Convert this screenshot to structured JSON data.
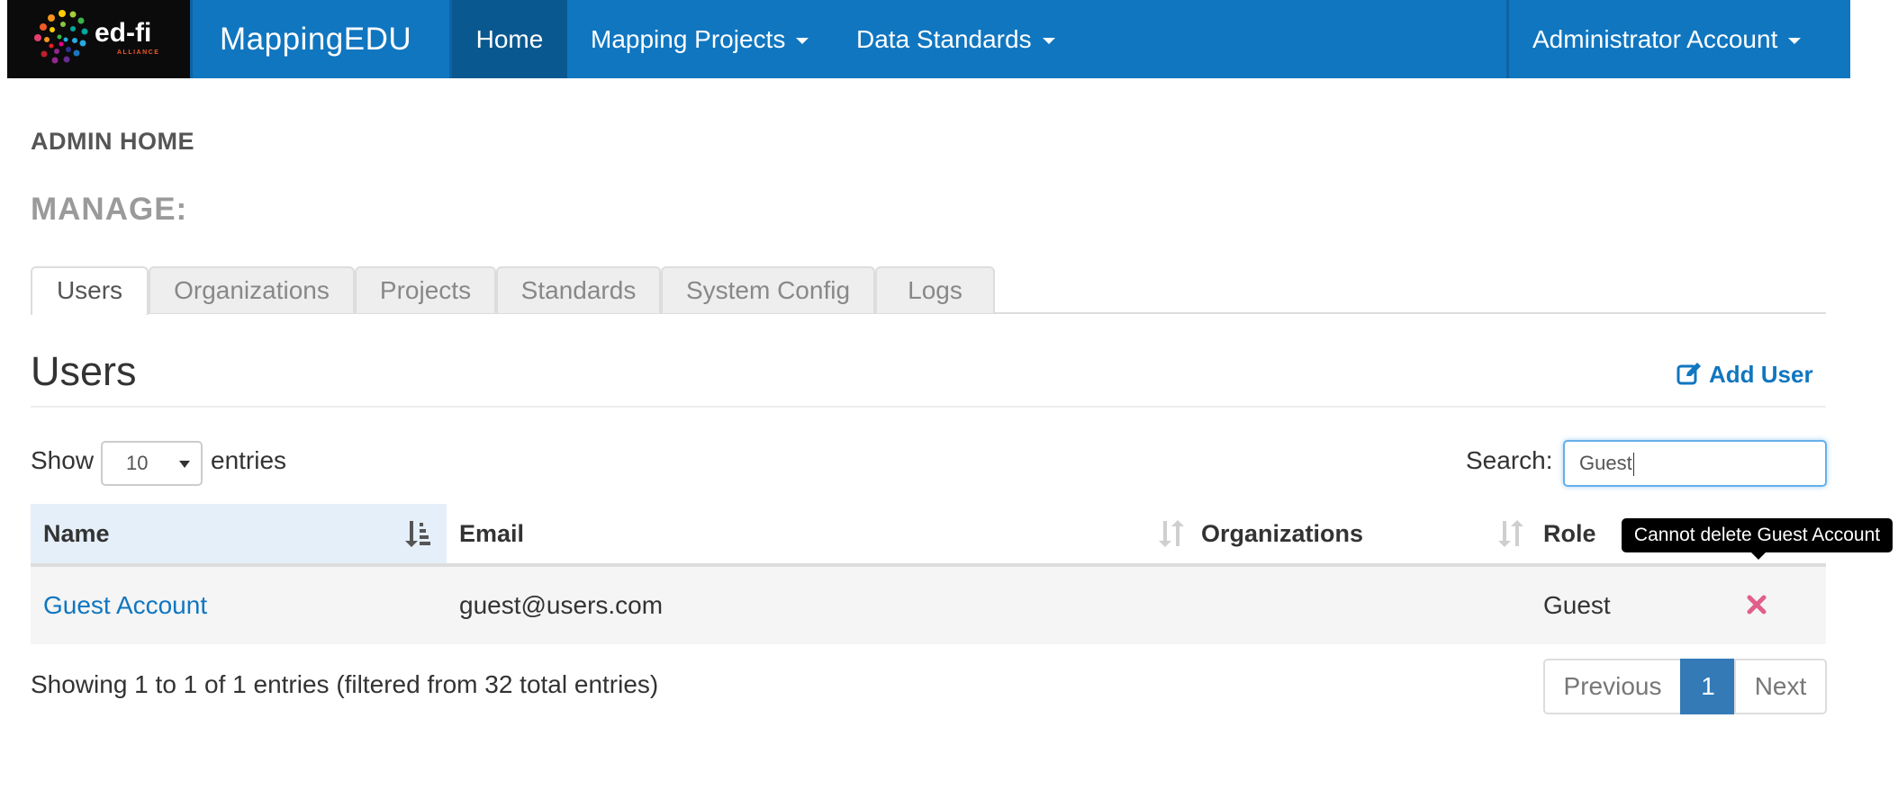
{
  "navbar": {
    "logo": {
      "wordmark": "ed-fi",
      "sub": "ALLIANCE"
    },
    "app_name": "MappingEDU",
    "items": [
      {
        "label": "Home",
        "active": true
      },
      {
        "label": "Mapping Projects",
        "dropdown": true
      },
      {
        "label": "Data Standards",
        "dropdown": true
      }
    ],
    "account": {
      "label": "Administrator Account",
      "dropdown": true
    },
    "colors": {
      "bar": "#1076c0",
      "active": "#0a5890",
      "logo_bg": "#0b0b0b"
    }
  },
  "page": {
    "heading": "ADMIN HOME",
    "manage_label": "MANAGE:"
  },
  "tabs": [
    {
      "label": "Users",
      "active": true
    },
    {
      "label": "Organizations"
    },
    {
      "label": "Projects"
    },
    {
      "label": "Standards"
    },
    {
      "label": "System Config"
    },
    {
      "label": "Logs"
    }
  ],
  "users": {
    "title": "Users",
    "add_label": "Add User",
    "add_icon": "edit-icon",
    "length": {
      "show": "Show",
      "value": "10",
      "entries": "entries"
    },
    "search": {
      "label": "Search:",
      "value": "Guest"
    },
    "columns": [
      {
        "label": "Name",
        "sort": "ascending"
      },
      {
        "label": "Email",
        "sort": "both"
      },
      {
        "label": "Organizations",
        "sort": "both"
      },
      {
        "label": "Role"
      },
      {
        "label": ""
      }
    ],
    "rows": [
      {
        "name": "Guest Account",
        "email": "guest@users.com",
        "organizations": "",
        "role": "Guest",
        "action_icon": "close-icon",
        "action_color": "#e0608a"
      }
    ],
    "tooltip": "Cannot delete Guest Account",
    "info": "Showing 1 to 1 of 1 entries (filtered from 32 total entries)",
    "pagination": {
      "previous": "Previous",
      "current": "1",
      "next": "Next"
    }
  }
}
